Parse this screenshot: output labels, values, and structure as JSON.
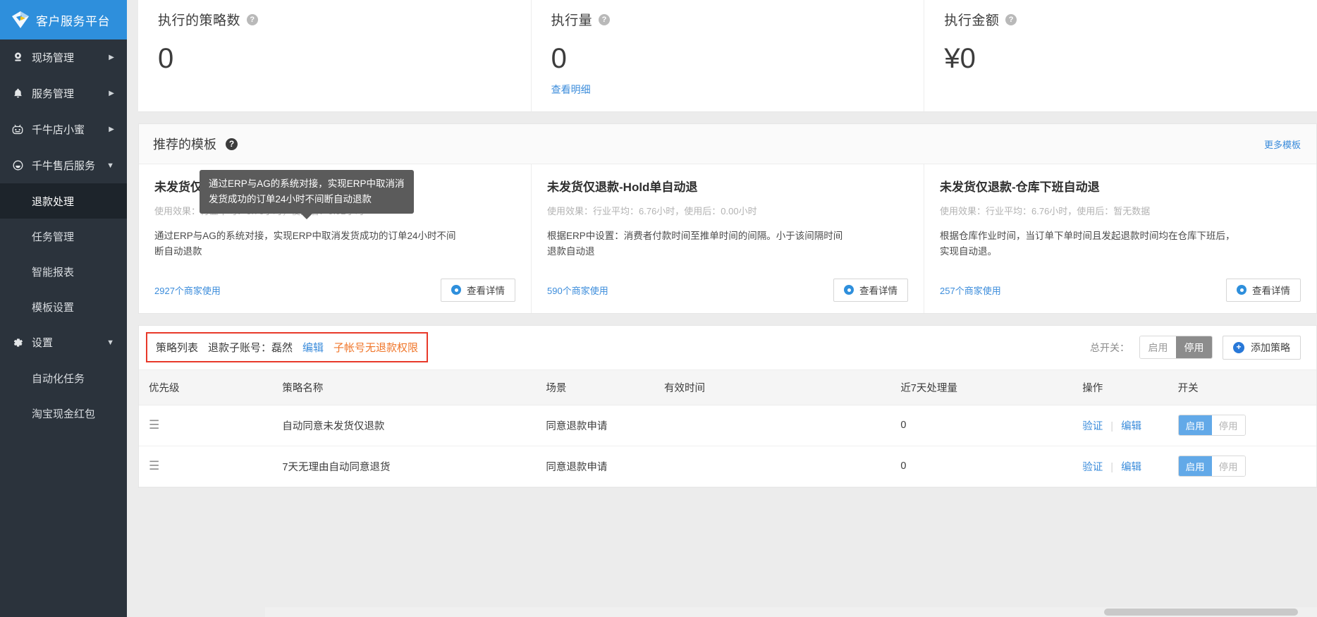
{
  "brand": {
    "title": "客户服务平台",
    "logo_icon": "diamond-logo-icon",
    "bg": "#2e8fdc"
  },
  "sidebar": {
    "items": [
      {
        "label": "现场管理",
        "icon": "user-circle-icon",
        "arrow": "▶"
      },
      {
        "label": "服务管理",
        "icon": "bell-icon",
        "arrow": "▶"
      },
      {
        "label": "千牛店小蜜",
        "icon": "robot-icon",
        "arrow": "▶"
      },
      {
        "label": "千牛售后服务",
        "icon": "shield-icon",
        "arrow": "▼"
      }
    ],
    "sub_items": [
      {
        "label": "退款处理",
        "active": true
      },
      {
        "label": "任务管理",
        "active": false
      },
      {
        "label": "智能报表",
        "active": false
      },
      {
        "label": "模板设置",
        "active": false
      }
    ],
    "settings": {
      "label": "设置",
      "icon": "gear-icon",
      "arrow": "▼"
    },
    "settings_sub": [
      {
        "label": "自动化任务"
      },
      {
        "label": "淘宝现金红包"
      }
    ]
  },
  "stats": [
    {
      "title": "执行的策略数",
      "value": "0",
      "link": ""
    },
    {
      "title": "执行量",
      "value": "0",
      "link": "查看明细"
    },
    {
      "title": "执行金额",
      "value": "¥0",
      "link": ""
    }
  ],
  "templates": {
    "title": "推荐的模板",
    "more_label": "更多模板",
    "detail_label": "查看详情",
    "cards": [
      {
        "name": "未发货仅退款-ERP取消发货自动退",
        "effect": "使用效果：行业平均：6.76小时，使用后：0.92小时",
        "desc": "通过ERP与AG的系统对接，实现ERP中取消发货成功的订单24小时不间断自动退款",
        "users": "2927",
        "users_suffix": "个商家使用"
      },
      {
        "name": "未发货仅退款-Hold单自动退",
        "effect": "使用效果：行业平均：6.76小时，使用后：0.00小时",
        "desc": "根据ERP中设置：消费者付款时间至推单时间的间隔。小于该间隔时间退款自动退",
        "users": "590",
        "users_suffix": "个商家使用"
      },
      {
        "name": "未发货仅退款-仓库下班自动退",
        "effect": "使用效果：行业平均：6.76小时，使用后：暂无数据",
        "desc": "根据仓库作业时间，当订单下单时间且发起退款时间均在仓库下班后，实现自动退。",
        "users": "257",
        "users_suffix": "个商家使用"
      }
    ],
    "tooltip": {
      "line1": "通过ERP与AG的系统对接，实现ERP中取消消",
      "line2": "发货成功的订单24小时不间断自动退款"
    }
  },
  "strategy_list": {
    "title": "策略列表",
    "sub_account_label": "退款子账号：磊然",
    "edit_label": "编辑",
    "warning": "子帐号无退款权限",
    "master_switch_label": "总开关：",
    "enable_label": "启用",
    "disable_label": "停用",
    "master_state": "停用",
    "add_label": "添加策略",
    "columns": [
      "优先级",
      "策略名称",
      "场景",
      "有效时间",
      "近7天处理量",
      "操作",
      "开关"
    ],
    "rows": [
      {
        "priority_icon": "drag-handle-icon",
        "name": "自动同意未发货仅退款",
        "scene": "同意退款申请",
        "valid_time": "",
        "volume": "0",
        "ops": [
          "验证",
          "编辑"
        ],
        "switch_state": "启用"
      },
      {
        "priority_icon": "drag-handle-icon",
        "name": "7天无理由自动同意退货",
        "scene": "同意退款申请",
        "valid_time": "",
        "volume": "0",
        "ops": [
          "验证",
          "编辑"
        ],
        "switch_state": "启用"
      }
    ]
  },
  "colors": {
    "accent": "#3b8cdb",
    "brand_blue": "#2e8fdc",
    "sidebar": "#2b333c",
    "warning": "#f0762a",
    "highlight_border": "#e8392a"
  }
}
